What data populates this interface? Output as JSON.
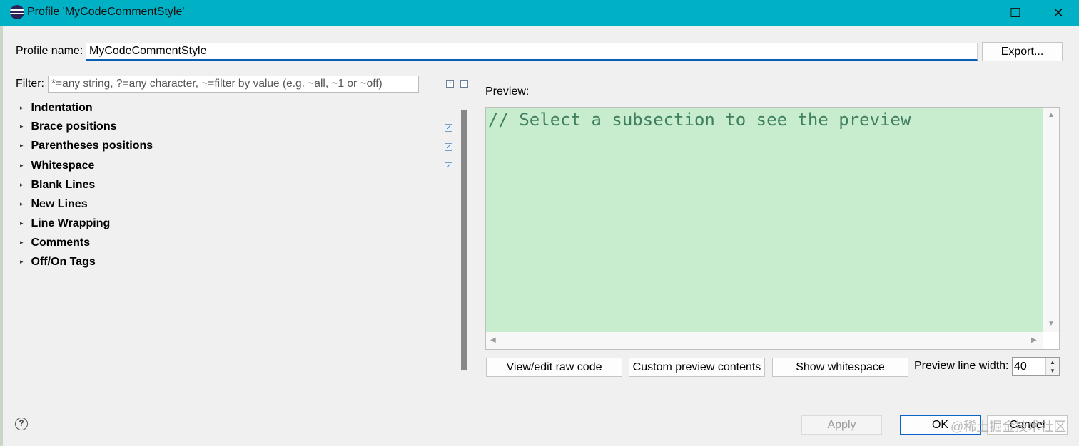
{
  "window": {
    "title": "Profile 'MyCodeCommentStyle'",
    "maximize_glyph": "☐",
    "close_glyph": "✕"
  },
  "profile": {
    "label": "Profile name:",
    "value": "MyCodeCommentStyle",
    "export_label": "Export..."
  },
  "filter": {
    "label": "Filter:",
    "placeholder": "*=any string, ?=any character, ~=filter by value (e.g. ~all, ~1 or ~off)",
    "expand_all_glyph": "+",
    "collapse_all_glyph": "−"
  },
  "tree": {
    "items": [
      {
        "label": "Indentation",
        "checked": false
      },
      {
        "label": "Brace positions",
        "checked": true
      },
      {
        "label": "Parentheses positions",
        "checked": true
      },
      {
        "label": "Whitespace",
        "checked": true
      },
      {
        "label": "Blank Lines",
        "checked": false
      },
      {
        "label": "New Lines",
        "checked": false
      },
      {
        "label": "Line Wrapping",
        "checked": false
      },
      {
        "label": "Comments",
        "checked": false
      },
      {
        "label": "Off/On Tags",
        "checked": false
      }
    ],
    "arrow_glyph": "▸",
    "check_glyph": "✓"
  },
  "preview": {
    "label": "Preview:",
    "code": "// Select a subsection to see the preview",
    "code_color": "#3f7f5f",
    "background_color": "#c8ecce",
    "view_raw_label": "View/edit raw code",
    "custom_contents_label": "Custom preview contents",
    "show_whitespace_label": "Show whitespace",
    "line_width_label": "Preview line width:",
    "line_width_value": "40"
  },
  "footer": {
    "help_glyph": "?",
    "apply_label": "Apply",
    "ok_label": "OK",
    "cancel_label": "Cancel",
    "watermark": "@稀土掘金技术社区"
  },
  "colors": {
    "titlebar": "#00b0c4",
    "focus_accent": "#0a5fb4"
  }
}
